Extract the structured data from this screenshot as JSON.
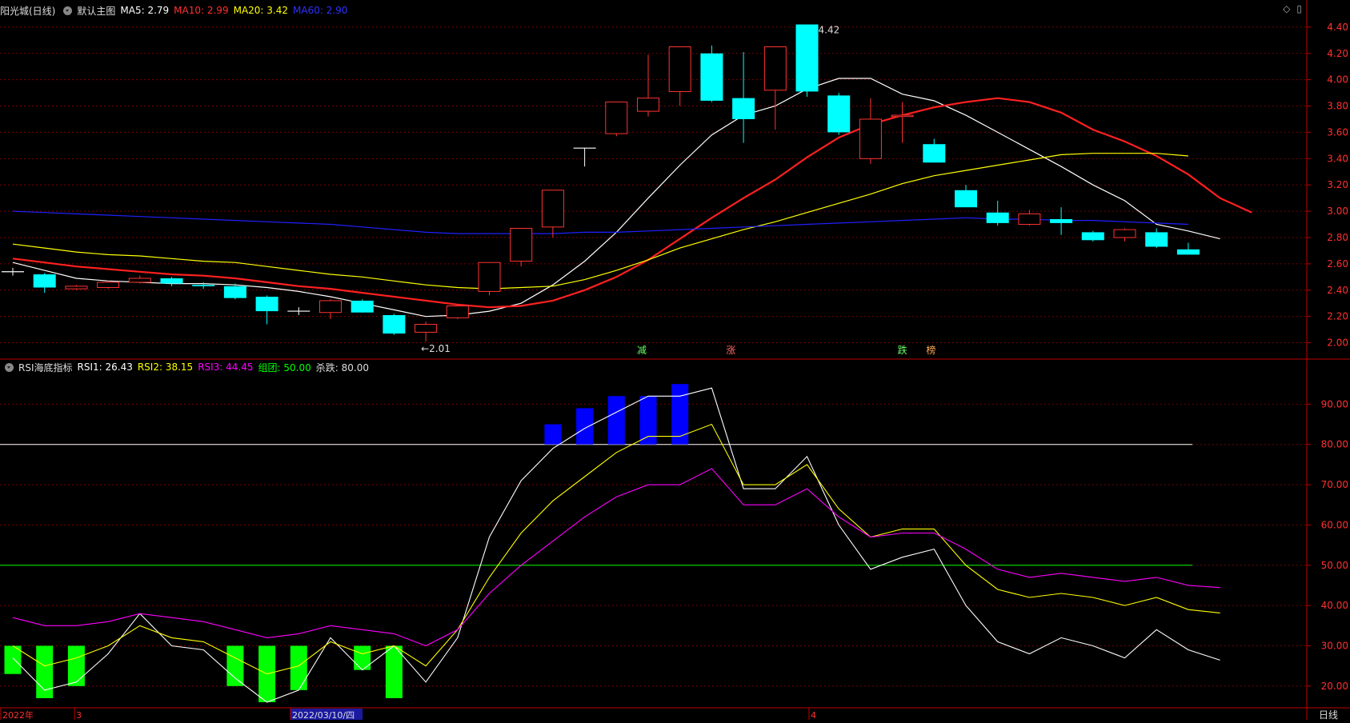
{
  "colors": {
    "up": "#ff3232",
    "down": "#00ffff",
    "ma5": "#ffffff",
    "ma10": "#ff2020",
    "ma20": "#ffff00",
    "ma60": "#2020ff",
    "grid": "#7a0000",
    "axis": "#c00000",
    "rsi1": "#ffffff",
    "rsi2": "#ffff00",
    "rsi3": "#ff00ff",
    "group": "#00ff00",
    "sell": "#ffffff",
    "green_bar": "#00ff00",
    "blue_bar": "#0000ff"
  },
  "header_top": {
    "stock_name": "阳光城(日线)",
    "main_chart": "默认主图",
    "ma5": "MA5: 2.79",
    "ma10": "MA10: 2.99",
    "ma20": "MA20: 3.42",
    "ma60": "MA60: 2.90"
  },
  "header_bottom": {
    "indicator": "RSI海底指标",
    "rsi1": "RSI1: 26.43",
    "rsi2": "RSI2: 38.15",
    "rsi3": "RSI3: 44.45",
    "group": "组团: 50.00",
    "sell": "杀跌: 80.00"
  },
  "toolbar_icons": [
    "diamond-icon",
    "square-icon"
  ],
  "axis_bottom": {
    "labels": [
      "2022年",
      "3",
      "2022/03/10/四",
      "4"
    ],
    "period": "日线"
  },
  "annotations": {
    "high": "4.42",
    "low": "←2.01",
    "signals": [
      "减",
      "涨",
      "跌",
      "榜"
    ]
  },
  "chart_data": [
    {
      "type": "candlestick",
      "title": "阳光城(日线)",
      "ylim": [
        1.9,
        4.46
      ],
      "yticks": [
        2.0,
        2.2,
        2.4,
        2.6,
        2.8,
        3.0,
        3.2,
        3.4,
        3.6,
        3.8,
        4.0,
        4.2,
        4.4
      ],
      "grid": true,
      "candles": [
        {
          "o": 2.54,
          "h": 2.57,
          "l": 2.51,
          "c": 2.54
        },
        {
          "o": 2.52,
          "h": 2.53,
          "l": 2.38,
          "c": 2.42
        },
        {
          "o": 2.41,
          "h": 2.44,
          "l": 2.4,
          "c": 2.43
        },
        {
          "o": 2.42,
          "h": 2.47,
          "l": 2.41,
          "c": 2.46
        },
        {
          "o": 2.46,
          "h": 2.51,
          "l": 2.45,
          "c": 2.49
        },
        {
          "o": 2.49,
          "h": 2.5,
          "l": 2.43,
          "c": 2.45
        },
        {
          "o": 2.44,
          "h": 2.46,
          "l": 2.41,
          "c": 2.43
        },
        {
          "o": 2.43,
          "h": 2.45,
          "l": 2.33,
          "c": 2.34
        },
        {
          "o": 2.35,
          "h": 2.36,
          "l": 2.14,
          "c": 2.24
        },
        {
          "o": 2.24,
          "h": 2.27,
          "l": 2.21,
          "c": 2.24
        },
        {
          "o": 2.23,
          "h": 2.33,
          "l": 2.18,
          "c": 2.32
        },
        {
          "o": 2.32,
          "h": 2.33,
          "l": 2.23,
          "c": 2.23
        },
        {
          "o": 2.21,
          "h": 2.22,
          "l": 2.06,
          "c": 2.07
        },
        {
          "o": 2.08,
          "h": 2.16,
          "l": 2.01,
          "c": 2.14
        },
        {
          "o": 2.19,
          "h": 2.28,
          "l": 2.18,
          "c": 2.28
        },
        {
          "o": 2.39,
          "h": 2.61,
          "l": 2.36,
          "c": 2.61
        },
        {
          "o": 2.62,
          "h": 2.87,
          "l": 2.58,
          "c": 2.87
        },
        {
          "o": 2.88,
          "h": 3.16,
          "l": 2.8,
          "c": 3.16
        },
        {
          "o": 3.48,
          "h": 3.48,
          "l": 3.34,
          "c": 3.48
        },
        {
          "o": 3.59,
          "h": 3.83,
          "l": 3.57,
          "c": 3.83
        },
        {
          "o": 3.76,
          "h": 4.19,
          "l": 3.72,
          "c": 3.86
        },
        {
          "o": 3.91,
          "h": 4.25,
          "l": 3.8,
          "c": 4.25
        },
        {
          "o": 4.2,
          "h": 4.26,
          "l": 3.83,
          "c": 3.84
        },
        {
          "o": 3.86,
          "h": 4.21,
          "l": 3.52,
          "c": 3.7
        },
        {
          "o": 3.92,
          "h": 4.25,
          "l": 3.62,
          "c": 4.25
        },
        {
          "o": 4.42,
          "h": 4.42,
          "l": 3.87,
          "c": 3.91
        },
        {
          "o": 3.88,
          "h": 3.9,
          "l": 3.58,
          "c": 3.6
        },
        {
          "o": 3.4,
          "h": 3.86,
          "l": 3.36,
          "c": 3.7
        },
        {
          "o": 3.72,
          "h": 3.83,
          "l": 3.52,
          "c": 3.73
        },
        {
          "o": 3.51,
          "h": 3.55,
          "l": 3.37,
          "c": 3.37
        },
        {
          "o": 3.16,
          "h": 3.2,
          "l": 3.03,
          "c": 3.03
        },
        {
          "o": 2.99,
          "h": 3.08,
          "l": 2.89,
          "c": 2.91
        },
        {
          "o": 2.9,
          "h": 3.01,
          "l": 2.89,
          "c": 2.98
        },
        {
          "o": 2.94,
          "h": 3.03,
          "l": 2.82,
          "c": 2.91
        },
        {
          "o": 2.84,
          "h": 2.85,
          "l": 2.77,
          "c": 2.78
        },
        {
          "o": 2.8,
          "h": 2.87,
          "l": 2.77,
          "c": 2.86
        },
        {
          "o": 2.84,
          "h": 2.87,
          "l": 2.72,
          "c": 2.73
        },
        {
          "o": 2.71,
          "h": 2.76,
          "l": 2.67,
          "c": 2.67
        }
      ],
      "series": [
        {
          "name": "MA5",
          "values": [
            2.61,
            2.55,
            2.49,
            2.47,
            2.46,
            2.45,
            2.45,
            2.44,
            2.42,
            2.39,
            2.35,
            2.3,
            2.25,
            2.2,
            2.21,
            2.24,
            2.3,
            2.44,
            2.62,
            2.84,
            3.1,
            3.35,
            3.58,
            3.73,
            3.8,
            3.93,
            4.01,
            4.01,
            3.89,
            3.84,
            3.73,
            3.6,
            3.47,
            3.34,
            3.2,
            3.08,
            2.9,
            2.85,
            2.79
          ]
        },
        {
          "name": "MA10",
          "values": [
            2.64,
            2.61,
            2.58,
            2.56,
            2.54,
            2.52,
            2.51,
            2.49,
            2.46,
            2.43,
            2.41,
            2.38,
            2.35,
            2.32,
            2.29,
            2.27,
            2.28,
            2.32,
            2.4,
            2.5,
            2.63,
            2.79,
            2.95,
            3.1,
            3.24,
            3.41,
            3.56,
            3.66,
            3.73,
            3.79,
            3.83,
            3.86,
            3.83,
            3.75,
            3.62,
            3.53,
            3.42,
            3.28,
            3.1,
            2.99
          ]
        },
        {
          "name": "MA20",
          "values": [
            2.75,
            2.72,
            2.69,
            2.67,
            2.66,
            2.64,
            2.62,
            2.61,
            2.58,
            2.55,
            2.52,
            2.5,
            2.47,
            2.44,
            2.42,
            2.41,
            2.42,
            2.43,
            2.48,
            2.55,
            2.63,
            2.72,
            2.79,
            2.86,
            2.92,
            2.99,
            3.06,
            3.13,
            3.21,
            3.27,
            3.31,
            3.35,
            3.39,
            3.43,
            3.44,
            3.44,
            3.44,
            3.42
          ]
        },
        {
          "name": "MA60",
          "values": [
            3.0,
            2.99,
            2.98,
            2.97,
            2.96,
            2.95,
            2.94,
            2.93,
            2.92,
            2.91,
            2.9,
            2.88,
            2.86,
            2.84,
            2.83,
            2.83,
            2.83,
            2.83,
            2.84,
            2.84,
            2.85,
            2.86,
            2.87,
            2.88,
            2.89,
            2.9,
            2.91,
            2.92,
            2.93,
            2.94,
            2.95,
            2.94,
            2.94,
            2.93,
            2.93,
            2.92,
            2.91,
            2.9
          ]
        }
      ]
    },
    {
      "type": "line",
      "title": "RSI海底指标",
      "ylim": [
        15,
        100
      ],
      "yticks": [
        20,
        30,
        40,
        50,
        60,
        70,
        80,
        90
      ],
      "grid": true,
      "hlines": [
        {
          "name": "组团",
          "value": 50
        },
        {
          "name": "杀跌",
          "value": 80
        }
      ],
      "series": [
        {
          "name": "RSI1",
          "values": [
            27,
            19,
            21,
            28,
            38,
            30,
            29,
            22,
            16,
            19,
            32,
            24,
            30,
            21,
            32,
            57,
            71,
            79,
            84,
            88,
            92,
            92,
            94,
            69,
            69,
            77,
            60,
            49,
            52,
            54,
            40,
            31,
            28,
            32,
            30,
            27,
            34,
            29,
            26.43
          ]
        },
        {
          "name": "RSI2",
          "values": [
            30,
            25,
            27,
            30,
            35,
            32,
            31,
            27,
            23,
            25,
            31,
            28,
            30,
            25,
            34,
            47,
            58,
            66,
            72,
            78,
            82,
            82,
            85,
            70,
            70,
            75,
            64,
            57,
            59,
            59,
            50,
            44,
            42,
            43,
            42,
            40,
            42,
            39,
            38.15
          ]
        },
        {
          "name": "RSI3",
          "values": [
            37,
            35,
            35,
            36,
            38,
            37,
            36,
            34,
            32,
            33,
            35,
            34,
            33,
            30,
            34,
            43,
            50,
            56,
            62,
            67,
            70,
            70,
            74,
            65,
            65,
            69,
            62,
            57,
            58,
            58,
            54,
            49,
            47,
            48,
            47,
            46,
            47,
            45,
            44.45
          ]
        }
      ],
      "green_bars": [
        {
          "index": 0,
          "top": 30,
          "bottom": 23
        },
        {
          "index": 1,
          "top": 30,
          "bottom": 17
        },
        {
          "index": 2,
          "top": 30,
          "bottom": 20
        },
        {
          "index": 7,
          "top": 30,
          "bottom": 20
        },
        {
          "index": 8,
          "top": 30,
          "bottom": 16
        },
        {
          "index": 9,
          "top": 30,
          "bottom": 19
        },
        {
          "index": 11,
          "top": 30,
          "bottom": 24
        },
        {
          "index": 12,
          "top": 30,
          "bottom": 17
        }
      ],
      "blue_bars": [
        {
          "index": 17,
          "top": 85,
          "bottom": 80
        },
        {
          "index": 18,
          "top": 89,
          "bottom": 80
        },
        {
          "index": 19,
          "top": 92,
          "bottom": 80
        },
        {
          "index": 20,
          "top": 92,
          "bottom": 80
        },
        {
          "index": 21,
          "top": 95,
          "bottom": 80
        }
      ]
    }
  ]
}
